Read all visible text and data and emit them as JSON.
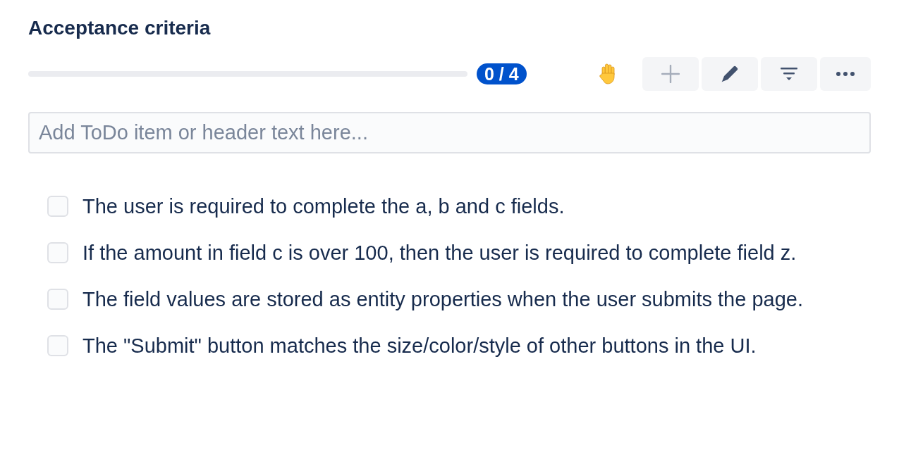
{
  "title": "Acceptance criteria",
  "progress": {
    "level": 0,
    "count": "0 / 4"
  },
  "toolbar": [
    {
      "kind": "add",
      "disabled": true
    },
    {
      "kind": "edit",
      "disabled": false
    },
    {
      "kind": "filter",
      "disabled": false
    },
    {
      "kind": "more",
      "disabled": false
    }
  ],
  "new_item": {
    "placeholder": "Add ToDo item or header text here..."
  },
  "items": [
    {
      "text": "The user is required to complete the a, b and c fields.",
      "checked": false
    },
    {
      "text": "If the amount in field c is over 100, then the user is required to complete field z.",
      "checked": false
    },
    {
      "text": "The field values are stored as entity properties when the user submits the page.",
      "checked": false
    },
    {
      "text": "The \"Submit\" button matches the size/color/style of other buttons in the UI.",
      "checked": false
    }
  ]
}
